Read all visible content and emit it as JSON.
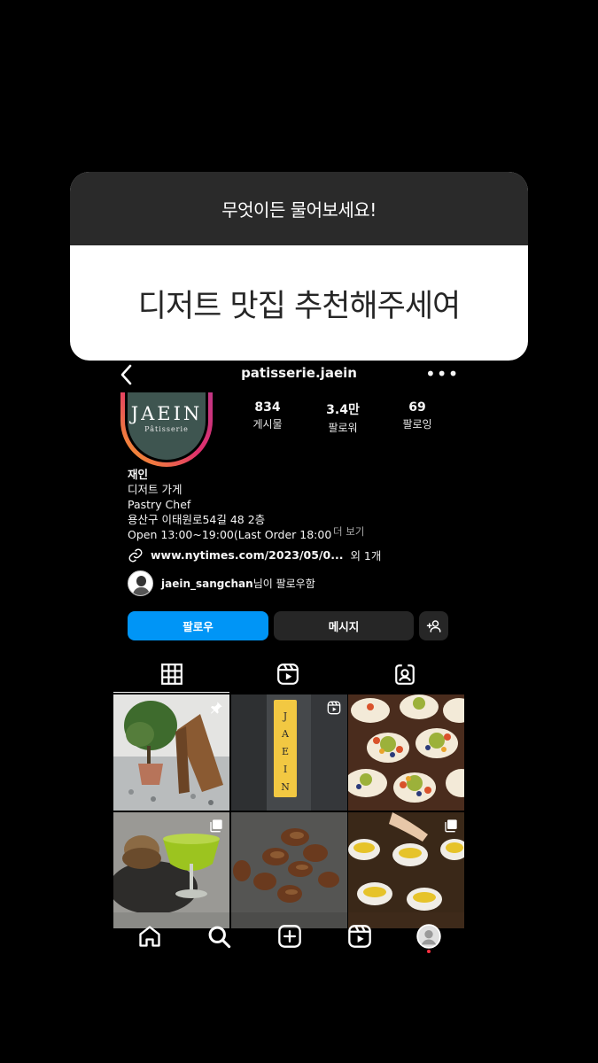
{
  "question": {
    "header": "무엇이든 물어보세요!",
    "answer": "디저트 맛집 추천해주세여"
  },
  "topbar": {
    "username": "patisserie.jaein",
    "more": "•••"
  },
  "avatar": {
    "logo_main": "JAEIN",
    "logo_sub": "Pâtisserie"
  },
  "stats": [
    {
      "num": "834",
      "label": "게시물"
    },
    {
      "num": "3.4만",
      "label": "팔로워"
    },
    {
      "num": "69",
      "label": "팔로잉"
    }
  ],
  "bio": {
    "name": "재인",
    "category": "디저트 가게",
    "line1": "Pastry Chef",
    "line2": "용산구 이태원로54길 48 2층",
    "line3": "Open 13:00~19:00(Last Order 18:00",
    "more": "더 보기",
    "link": "www.nytimes.com/2023/05/0...",
    "link_extra": "외 1개",
    "followed_name": "jaein_sangchan",
    "followed_suffix": "님이 팔로우함"
  },
  "buttons": {
    "follow": "팔로우",
    "message": "메시지"
  },
  "colors": {
    "follow_blue": "#0095f6",
    "button_dark": "#262626",
    "sticker_header": "#2a2a2a",
    "avatar_bg": "#3e5550",
    "notification_red": "#ff3040"
  },
  "icons": {
    "tabs": [
      "grid-icon",
      "reels-icon",
      "tagged-icon"
    ],
    "nav": [
      "home-icon",
      "search-icon",
      "create-icon",
      "reels-icon",
      "profile-icon"
    ]
  }
}
